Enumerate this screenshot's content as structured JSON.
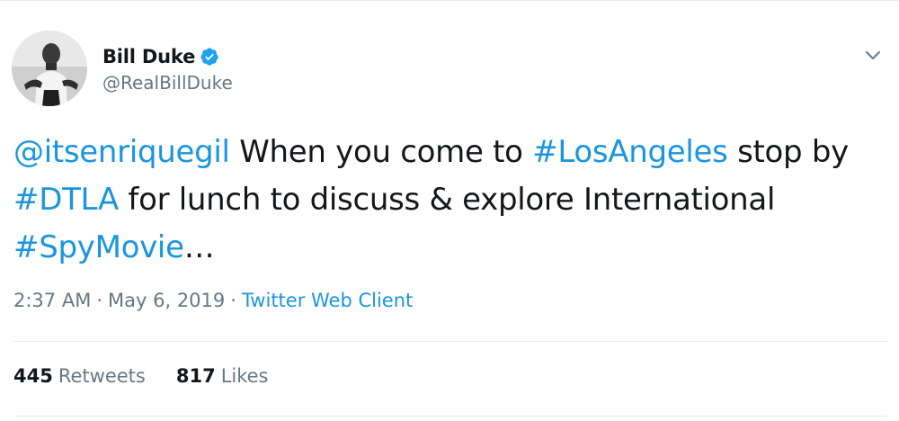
{
  "user": {
    "display_name": "Bill Duke",
    "handle": "@RealBillDuke",
    "verified": true,
    "avatar_icon": "profile-photo"
  },
  "tweet": {
    "mention": "@itsenriquegil",
    "text_1": " When you come to ",
    "hashtag_1": "#LosAngeles",
    "text_2": " stop by ",
    "hashtag_2": "#DTLA",
    "text_3": " for lunch to discuss & explore International ",
    "hashtag_3": "#SpyMovie",
    "text_4": "…"
  },
  "meta": {
    "time": "2:37 AM",
    "separator": "·",
    "date": "May 6, 2019",
    "source": "Twitter Web Client"
  },
  "stats": {
    "retweets_count": "445",
    "retweets_label": "Retweets",
    "likes_count": "817",
    "likes_label": "Likes"
  },
  "colors": {
    "link": "#1b95e0",
    "secondary_text": "#657786",
    "primary_text": "#14171a",
    "divider": "#e6ecf0",
    "verified_badge": "#1da1f2"
  },
  "icons": {
    "verified": "verified-badge-icon",
    "more": "chevron-down-icon"
  }
}
